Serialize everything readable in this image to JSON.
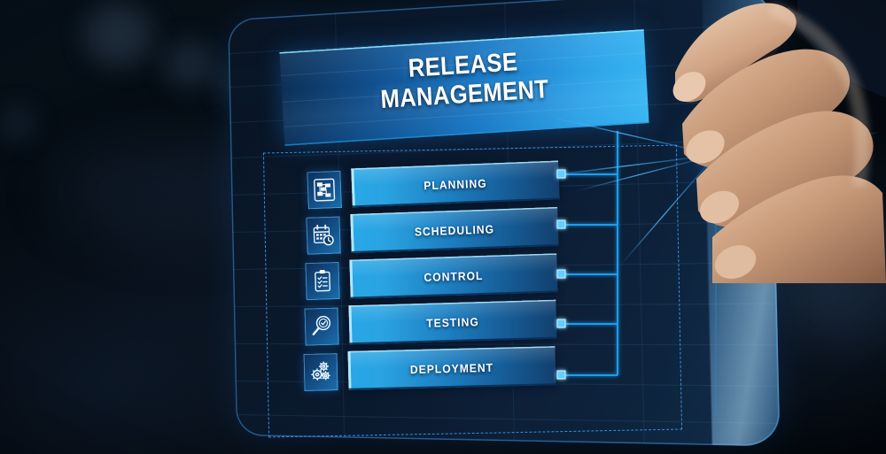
{
  "app": {
    "title_line1": "RELEASE",
    "title_line2": "MANAGEMENT",
    "theme": {
      "accent_cyan": "#2ea3e8",
      "accent_bright": "#37b6f2",
      "bar_start": "#27a7e6",
      "bar_end": "#123f6d",
      "background_dark": "#04080f",
      "connector_line": "#1f9df0",
      "text_primary": "#ffffff",
      "dashed_frame": "#3796eb"
    }
  },
  "process": {
    "steps": [
      {
        "label": "PLANNING",
        "icon": "flowchart-icon"
      },
      {
        "label": "SCHEDULING",
        "icon": "calendar-clock-icon"
      },
      {
        "label": "CONTROL",
        "icon": "clipboard-checklist-icon"
      },
      {
        "label": "TESTING",
        "icon": "magnifier-check-icon"
      },
      {
        "label": "DEPLOYMENT",
        "icon": "gears-icon"
      }
    ]
  },
  "scene": {
    "device": "touchscreen-tablet",
    "pointer": "hand-with-stylus",
    "touch_glow": "touch-point-glow"
  }
}
